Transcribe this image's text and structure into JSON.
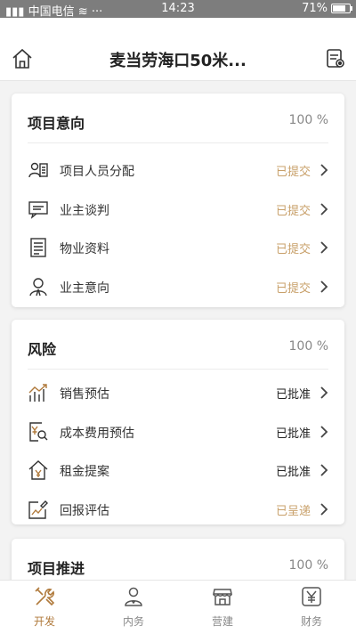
{
  "status_bar": {
    "carrier": "中国电信",
    "time": "14:23",
    "battery": "71%",
    "battery_level": 0.71
  },
  "header": {
    "title": "麦当劳海口50米..."
  },
  "sections": [
    {
      "title": "项目意向",
      "percent": "100 %",
      "items": [
        {
          "label": "项目人员分配",
          "status": "已提交",
          "icon": "staff-card-icon",
          "status_color": "#c8a06a"
        },
        {
          "label": "业主谈判",
          "status": "已提交",
          "icon": "chat-icon",
          "status_color": "#c8a06a"
        },
        {
          "label": "物业资料",
          "status": "已提交",
          "icon": "document-icon",
          "status_color": "#c8a06a"
        },
        {
          "label": "业主意向",
          "status": "已提交",
          "icon": "owner-icon",
          "status_color": "#c8a06a"
        }
      ]
    },
    {
      "title": "风险",
      "percent": "100 %",
      "items": [
        {
          "label": "销售预估",
          "status": "已批准",
          "icon": "sales-chart-icon",
          "status_color": "#222222"
        },
        {
          "label": "成本费用预估",
          "status": "已批准",
          "icon": "cost-search-icon",
          "status_color": "#222222"
        },
        {
          "label": "租金提案",
          "status": "已批准",
          "icon": "rent-house-icon",
          "status_color": "#222222"
        },
        {
          "label": "回报评估",
          "status": "已呈递",
          "icon": "edit-chart-icon",
          "status_color": "#c8a06a"
        }
      ]
    },
    {
      "title": "项目推进",
      "percent": "100 %",
      "items": []
    }
  ],
  "tabs": [
    {
      "label": "开发",
      "icon": "tools-icon",
      "active": true
    },
    {
      "label": "内务",
      "icon": "person-tie-icon",
      "active": false
    },
    {
      "label": "营建",
      "icon": "storefront-icon",
      "active": false
    },
    {
      "label": "财务",
      "icon": "yen-icon",
      "active": false
    }
  ],
  "colors": {
    "accent": "#b07a3c",
    "submitted": "#c8a06a",
    "approved": "#222222"
  }
}
